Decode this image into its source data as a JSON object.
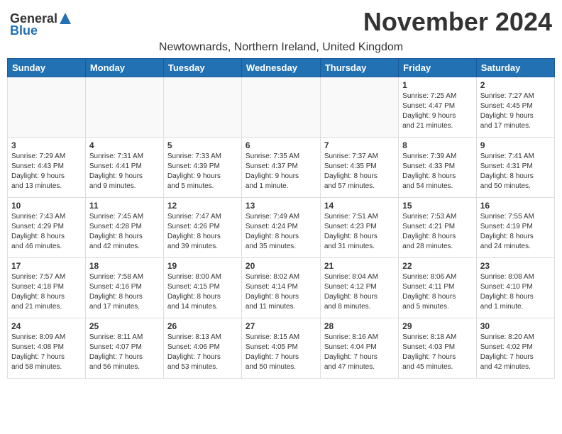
{
  "logo": {
    "general": "General",
    "blue": "Blue"
  },
  "title": "November 2024",
  "subtitle": "Newtownards, Northern Ireland, United Kingdom",
  "days_of_week": [
    "Sunday",
    "Monday",
    "Tuesday",
    "Wednesday",
    "Thursday",
    "Friday",
    "Saturday"
  ],
  "weeks": [
    [
      {
        "day": "",
        "info": ""
      },
      {
        "day": "",
        "info": ""
      },
      {
        "day": "",
        "info": ""
      },
      {
        "day": "",
        "info": ""
      },
      {
        "day": "",
        "info": ""
      },
      {
        "day": "1",
        "info": "Sunrise: 7:25 AM\nSunset: 4:47 PM\nDaylight: 9 hours\nand 21 minutes."
      },
      {
        "day": "2",
        "info": "Sunrise: 7:27 AM\nSunset: 4:45 PM\nDaylight: 9 hours\nand 17 minutes."
      }
    ],
    [
      {
        "day": "3",
        "info": "Sunrise: 7:29 AM\nSunset: 4:43 PM\nDaylight: 9 hours\nand 13 minutes."
      },
      {
        "day": "4",
        "info": "Sunrise: 7:31 AM\nSunset: 4:41 PM\nDaylight: 9 hours\nand 9 minutes."
      },
      {
        "day": "5",
        "info": "Sunrise: 7:33 AM\nSunset: 4:39 PM\nDaylight: 9 hours\nand 5 minutes."
      },
      {
        "day": "6",
        "info": "Sunrise: 7:35 AM\nSunset: 4:37 PM\nDaylight: 9 hours\nand 1 minute."
      },
      {
        "day": "7",
        "info": "Sunrise: 7:37 AM\nSunset: 4:35 PM\nDaylight: 8 hours\nand 57 minutes."
      },
      {
        "day": "8",
        "info": "Sunrise: 7:39 AM\nSunset: 4:33 PM\nDaylight: 8 hours\nand 54 minutes."
      },
      {
        "day": "9",
        "info": "Sunrise: 7:41 AM\nSunset: 4:31 PM\nDaylight: 8 hours\nand 50 minutes."
      }
    ],
    [
      {
        "day": "10",
        "info": "Sunrise: 7:43 AM\nSunset: 4:29 PM\nDaylight: 8 hours\nand 46 minutes."
      },
      {
        "day": "11",
        "info": "Sunrise: 7:45 AM\nSunset: 4:28 PM\nDaylight: 8 hours\nand 42 minutes."
      },
      {
        "day": "12",
        "info": "Sunrise: 7:47 AM\nSunset: 4:26 PM\nDaylight: 8 hours\nand 39 minutes."
      },
      {
        "day": "13",
        "info": "Sunrise: 7:49 AM\nSunset: 4:24 PM\nDaylight: 8 hours\nand 35 minutes."
      },
      {
        "day": "14",
        "info": "Sunrise: 7:51 AM\nSunset: 4:23 PM\nDaylight: 8 hours\nand 31 minutes."
      },
      {
        "day": "15",
        "info": "Sunrise: 7:53 AM\nSunset: 4:21 PM\nDaylight: 8 hours\nand 28 minutes."
      },
      {
        "day": "16",
        "info": "Sunrise: 7:55 AM\nSunset: 4:19 PM\nDaylight: 8 hours\nand 24 minutes."
      }
    ],
    [
      {
        "day": "17",
        "info": "Sunrise: 7:57 AM\nSunset: 4:18 PM\nDaylight: 8 hours\nand 21 minutes."
      },
      {
        "day": "18",
        "info": "Sunrise: 7:58 AM\nSunset: 4:16 PM\nDaylight: 8 hours\nand 17 minutes."
      },
      {
        "day": "19",
        "info": "Sunrise: 8:00 AM\nSunset: 4:15 PM\nDaylight: 8 hours\nand 14 minutes."
      },
      {
        "day": "20",
        "info": "Sunrise: 8:02 AM\nSunset: 4:14 PM\nDaylight: 8 hours\nand 11 minutes."
      },
      {
        "day": "21",
        "info": "Sunrise: 8:04 AM\nSunset: 4:12 PM\nDaylight: 8 hours\nand 8 minutes."
      },
      {
        "day": "22",
        "info": "Sunrise: 8:06 AM\nSunset: 4:11 PM\nDaylight: 8 hours\nand 5 minutes."
      },
      {
        "day": "23",
        "info": "Sunrise: 8:08 AM\nSunset: 4:10 PM\nDaylight: 8 hours\nand 1 minute."
      }
    ],
    [
      {
        "day": "24",
        "info": "Sunrise: 8:09 AM\nSunset: 4:08 PM\nDaylight: 7 hours\nand 58 minutes."
      },
      {
        "day": "25",
        "info": "Sunrise: 8:11 AM\nSunset: 4:07 PM\nDaylight: 7 hours\nand 56 minutes."
      },
      {
        "day": "26",
        "info": "Sunrise: 8:13 AM\nSunset: 4:06 PM\nDaylight: 7 hours\nand 53 minutes."
      },
      {
        "day": "27",
        "info": "Sunrise: 8:15 AM\nSunset: 4:05 PM\nDaylight: 7 hours\nand 50 minutes."
      },
      {
        "day": "28",
        "info": "Sunrise: 8:16 AM\nSunset: 4:04 PM\nDaylight: 7 hours\nand 47 minutes."
      },
      {
        "day": "29",
        "info": "Sunrise: 8:18 AM\nSunset: 4:03 PM\nDaylight: 7 hours\nand 45 minutes."
      },
      {
        "day": "30",
        "info": "Sunrise: 8:20 AM\nSunset: 4:02 PM\nDaylight: 7 hours\nand 42 minutes."
      }
    ]
  ]
}
